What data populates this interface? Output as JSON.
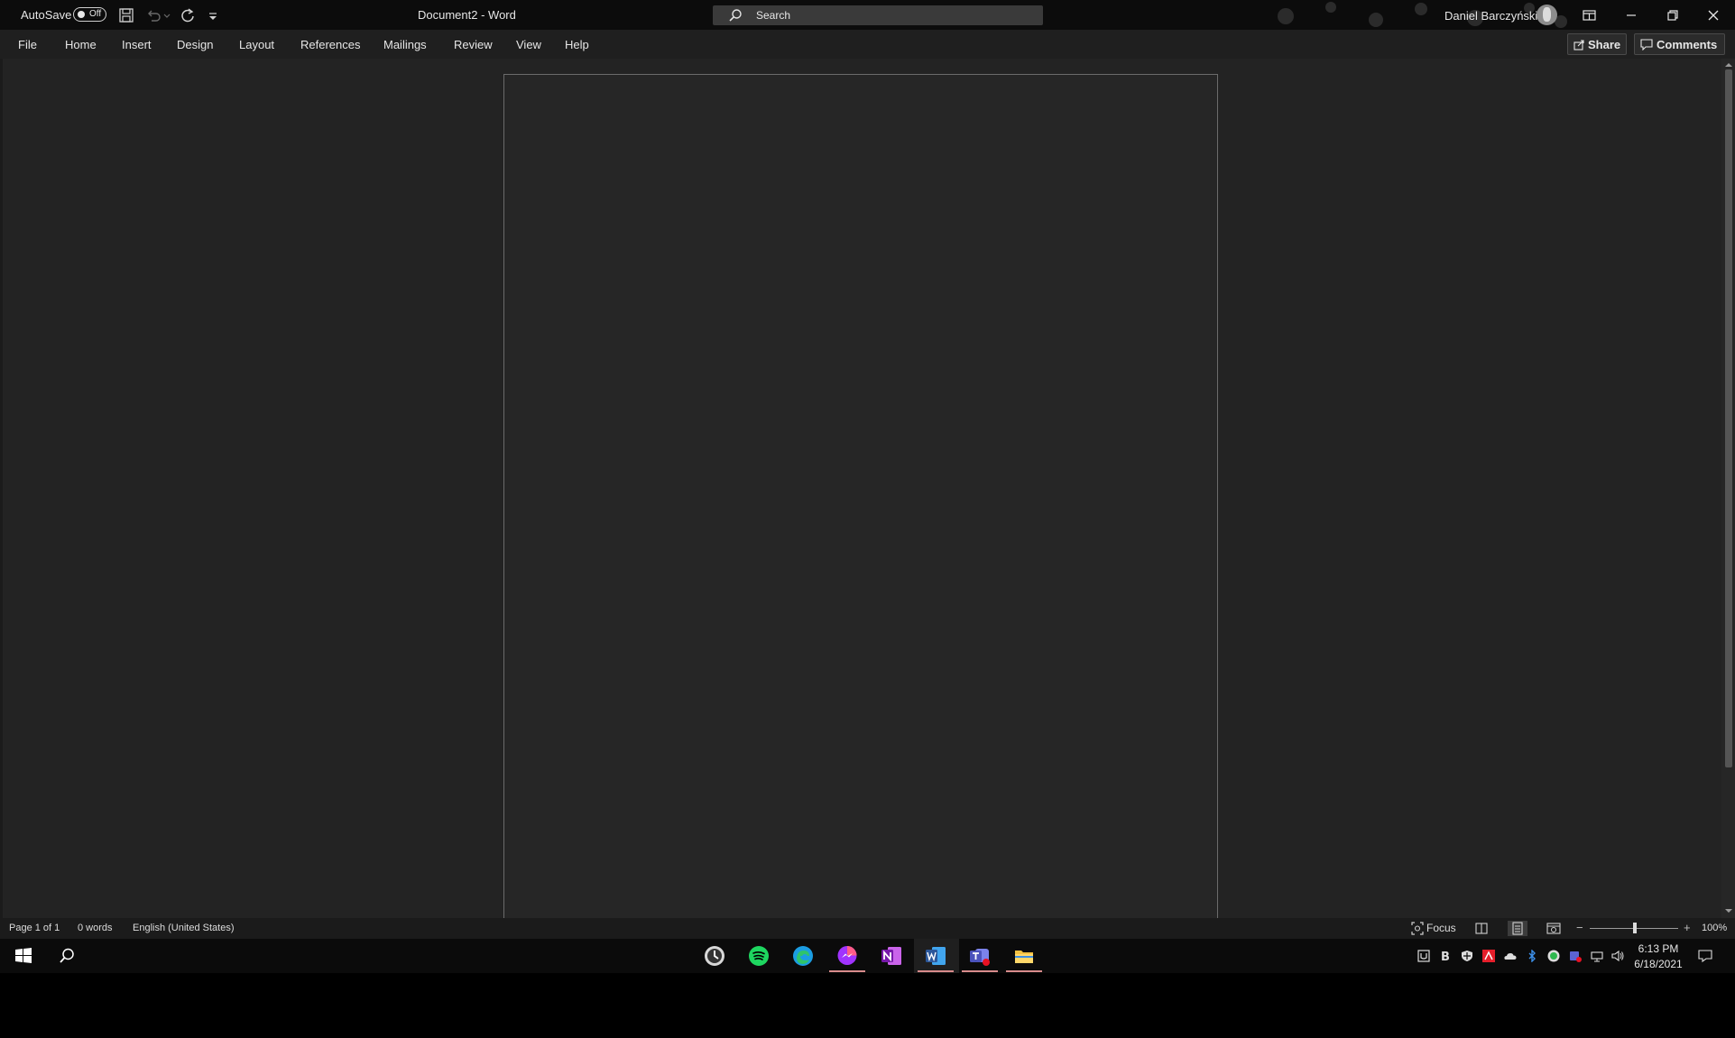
{
  "titlebar": {
    "autosave_label": "AutoSave",
    "autosave_state": "Off",
    "document_title": "Document2  -  Word",
    "search_placeholder": "Search",
    "user_name": "Daniel Barczyński"
  },
  "ribbon": {
    "tabs": [
      "File",
      "Home",
      "Insert",
      "Design",
      "Layout",
      "References",
      "Mailings",
      "Review",
      "View",
      "Help"
    ],
    "share_label": "Share",
    "comments_label": "Comments"
  },
  "statusbar": {
    "page_info": "Page 1 of 1",
    "word_count": "0 words",
    "language": "English (United States)",
    "focus_label": "Focus",
    "zoom_level": "100%"
  },
  "taskbar": {
    "time": "6:13 PM",
    "date": "6/18/2021",
    "pinned_apps": [
      "clock-app",
      "spotify",
      "edge",
      "messenger",
      "onenote",
      "word",
      "teams",
      "file-explorer"
    ]
  },
  "colors": {
    "background": "#232323",
    "page": "#262626",
    "titlebar": "#0c0c0c",
    "ribbon": "#1f1f1f",
    "word_blue": "#2b579a"
  }
}
